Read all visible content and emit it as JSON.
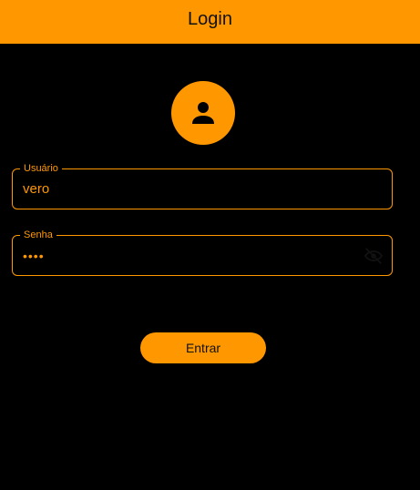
{
  "app_bar": {
    "title": "Login",
    "background_color": "#FF9800"
  },
  "avatar": {
    "icon": "person-icon",
    "background_color": "#FF9800"
  },
  "username_field": {
    "label": "Usuário",
    "value": "vero"
  },
  "password_field": {
    "label": "Senha",
    "value": "••••",
    "visibility_icon": "visibility-off-icon"
  },
  "login_button": {
    "label": "Entrar"
  },
  "colors": {
    "accent": "#FF9800",
    "background": "#000000"
  }
}
